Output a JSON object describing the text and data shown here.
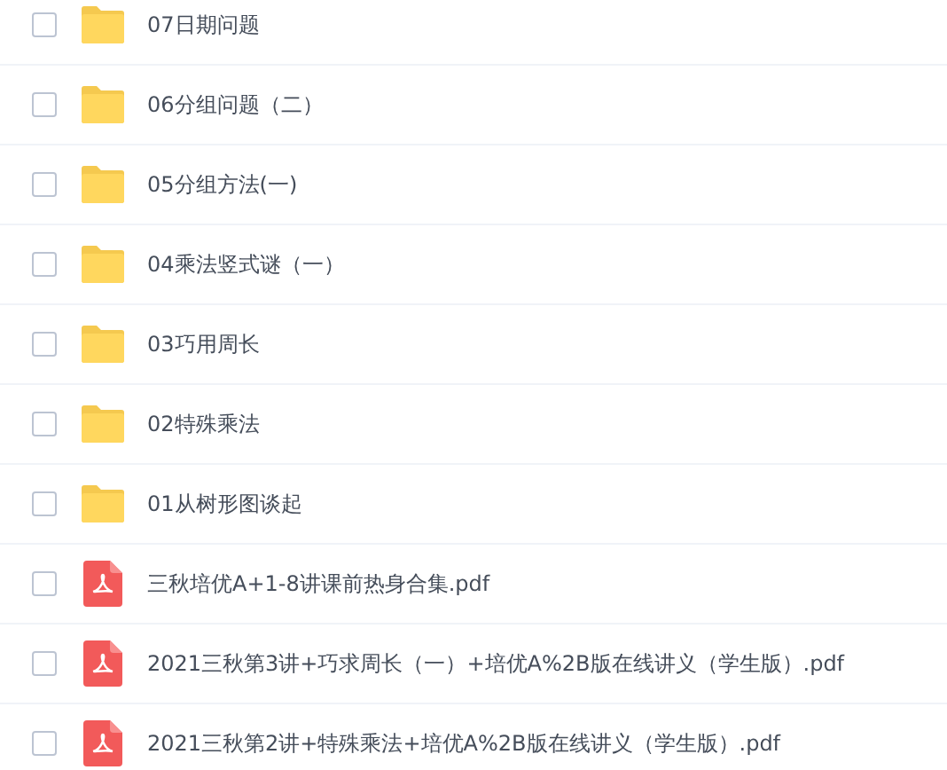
{
  "files": [
    {
      "kind": "folder",
      "name": "07日期问题",
      "checked": false
    },
    {
      "kind": "folder",
      "name": "06分组问题（二）",
      "checked": false
    },
    {
      "kind": "folder",
      "name": "05分组方法(一)",
      "checked": false
    },
    {
      "kind": "folder",
      "name": "04乘法竖式谜（一）",
      "checked": false
    },
    {
      "kind": "folder",
      "name": "03巧用周长",
      "checked": false
    },
    {
      "kind": "folder",
      "name": "02特殊乘法",
      "checked": false
    },
    {
      "kind": "folder",
      "name": "01从树形图谈起",
      "checked": false
    },
    {
      "kind": "pdf",
      "name": "三秋培优A+1-8讲课前热身合集.pdf",
      "checked": false
    },
    {
      "kind": "pdf",
      "name": "2021三秋第3讲+巧求周长（一）+培优A%2B版在线讲义（学生版）.pdf",
      "checked": false
    },
    {
      "kind": "pdf",
      "name": "2021三秋第2讲+特殊乘法+培优A%2B版在线讲义（学生版）.pdf",
      "checked": false
    }
  ]
}
